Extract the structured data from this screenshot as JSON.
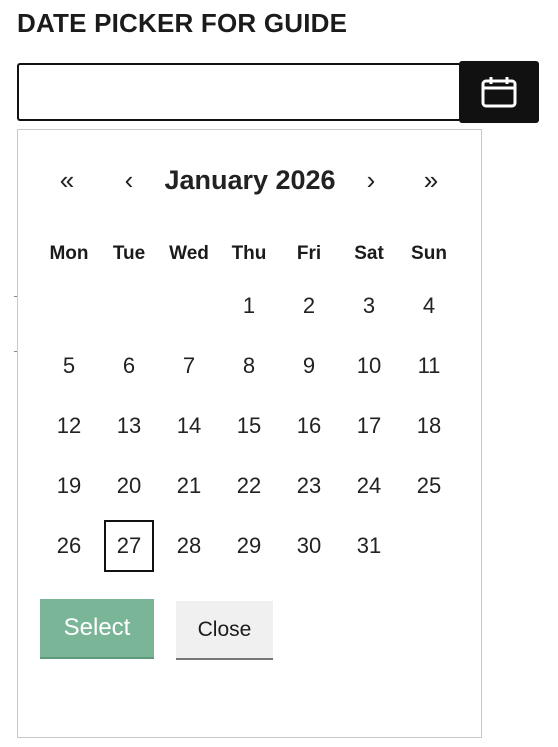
{
  "header": {
    "title": "DATE PICKER FOR GUIDE"
  },
  "date_input": {
    "value": "",
    "placeholder": ""
  },
  "calendar_button": {
    "icon": "calendar-icon"
  },
  "datepicker": {
    "nav": {
      "prev_year": "«",
      "prev_month": "‹",
      "next_month": "›",
      "next_year": "»"
    },
    "month_label": "January 2026",
    "weekdays": [
      "Mon",
      "Tue",
      "Wed",
      "Thu",
      "Fri",
      "Sat",
      "Sun"
    ],
    "leading_blanks": 3,
    "days": [
      "1",
      "2",
      "3",
      "4",
      "5",
      "6",
      "7",
      "8",
      "9",
      "10",
      "11",
      "12",
      "13",
      "14",
      "15",
      "16",
      "17",
      "18",
      "19",
      "20",
      "21",
      "22",
      "23",
      "24",
      "25",
      "26",
      "27",
      "28",
      "29",
      "30",
      "31"
    ],
    "highlighted_day": "27",
    "select_label": "Select",
    "close_label": "Close"
  },
  "colors": {
    "select_button": "#7ab598",
    "close_button": "#f0f0f0",
    "calendar_button": "#111111"
  }
}
